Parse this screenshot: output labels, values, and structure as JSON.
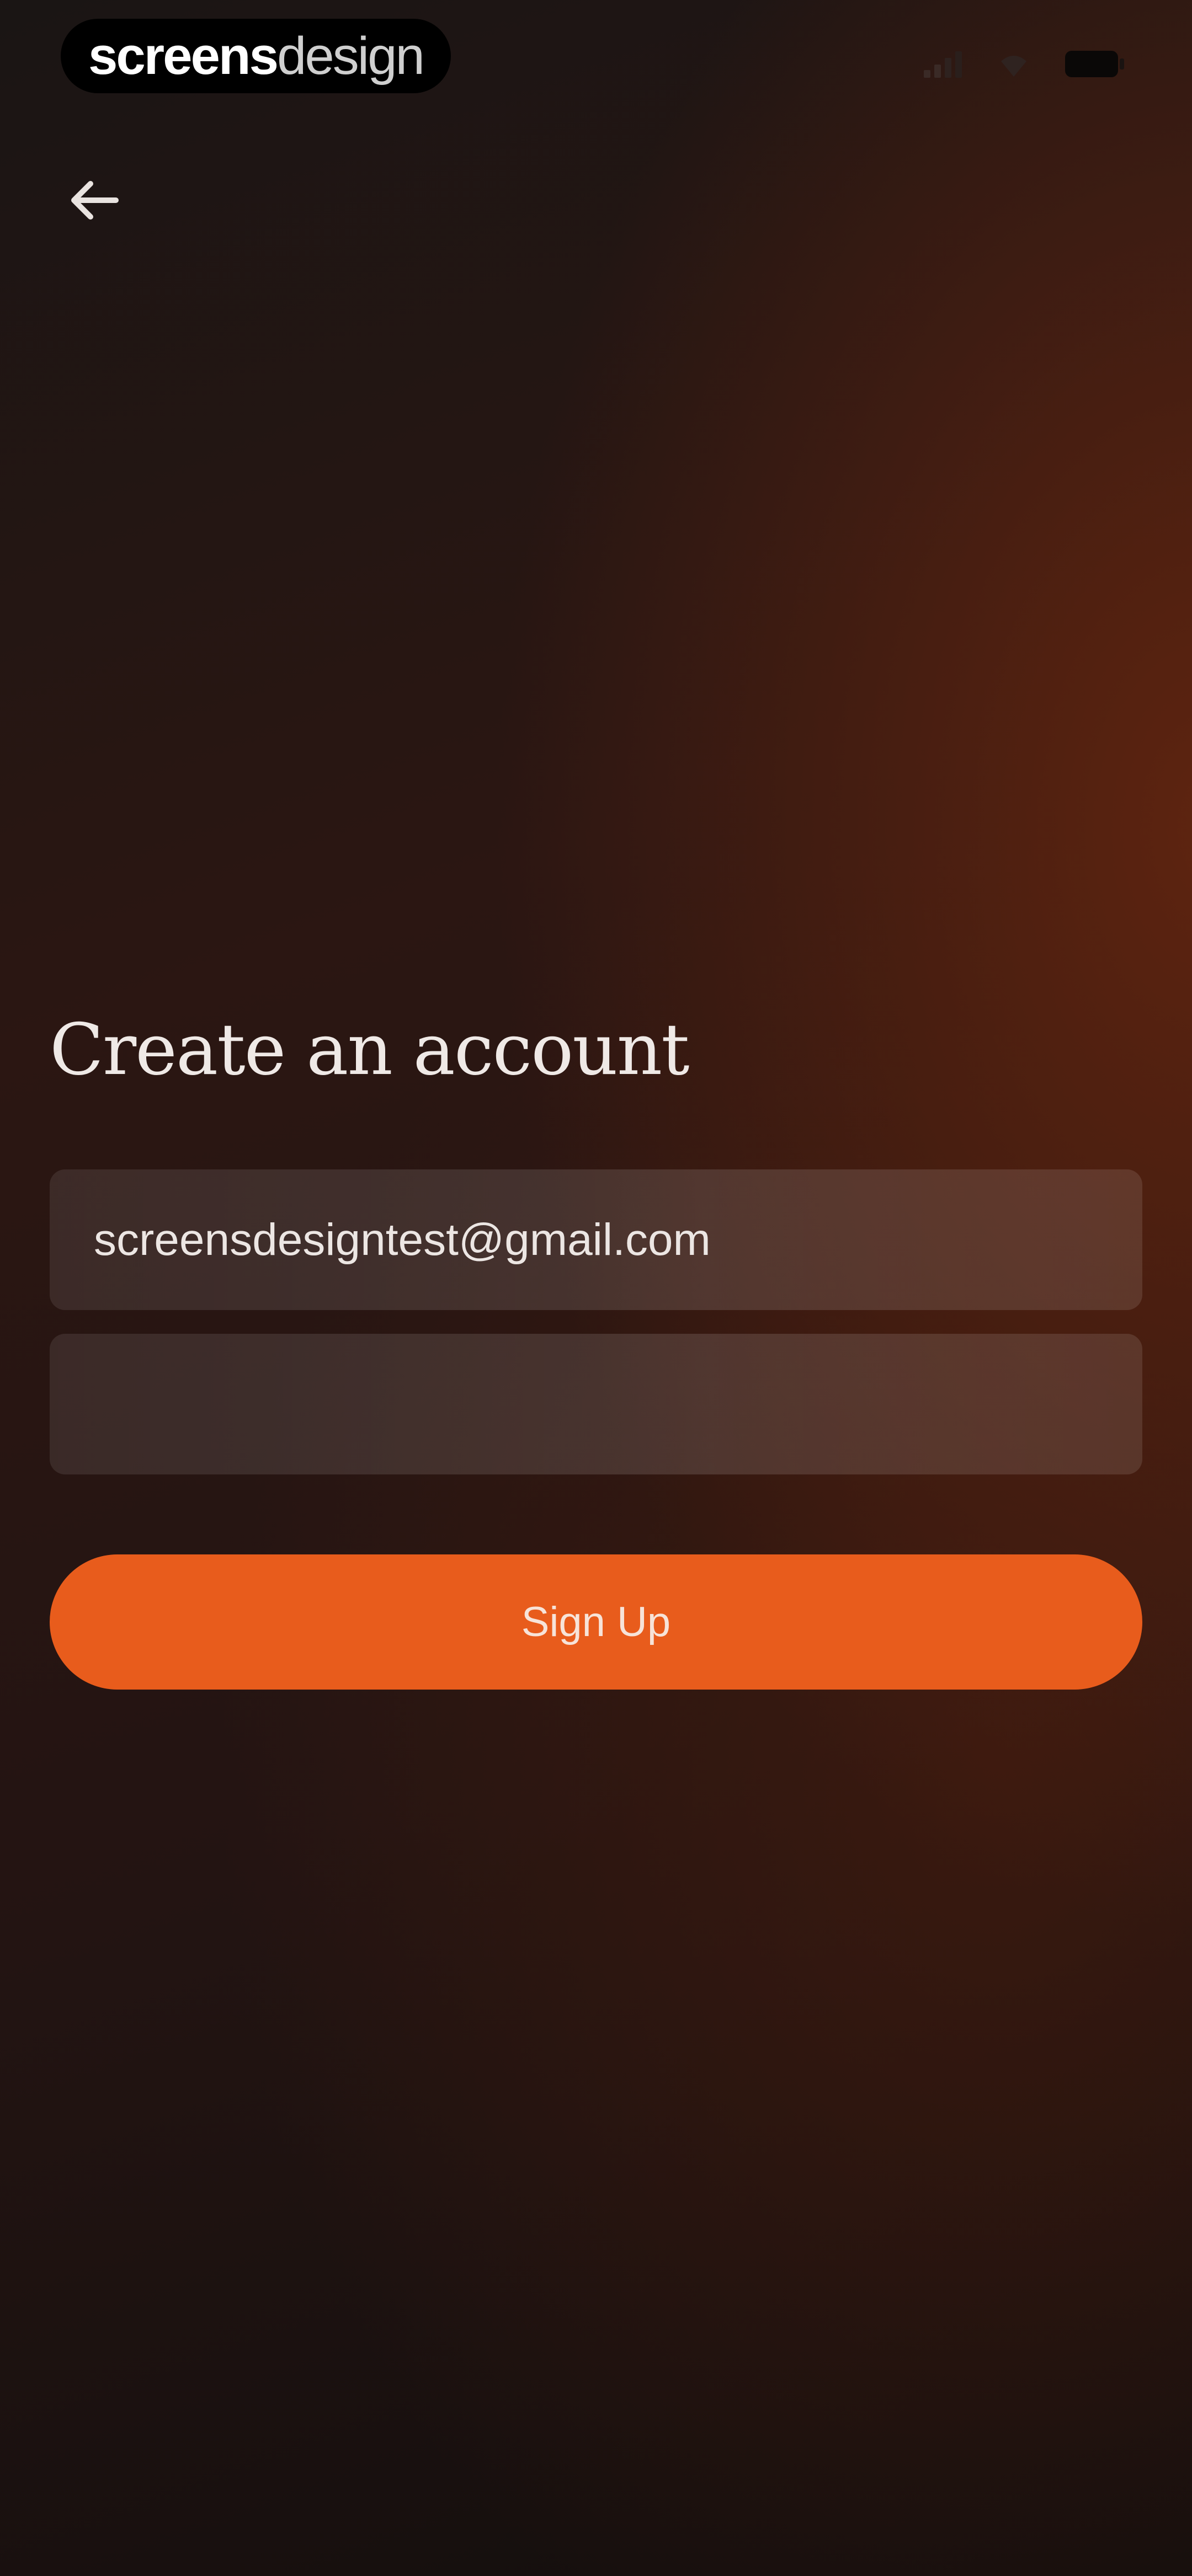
{
  "status_bar": {
    "brand_bold": "screens",
    "brand_light": "design",
    "icons": [
      "signal-icon",
      "wifi-icon",
      "battery-icon"
    ]
  },
  "nav": {
    "back_icon": "arrow-left-icon"
  },
  "form": {
    "title": "Create an account",
    "email_value": "screensdesigntest@gmail.com",
    "password_value": "",
    "submit_label": "Sign Up"
  },
  "colors": {
    "accent": "#e85c1c",
    "background_dark": "#1a1514",
    "background_warm": "#5e2410",
    "text_primary": "#efe9e6"
  }
}
